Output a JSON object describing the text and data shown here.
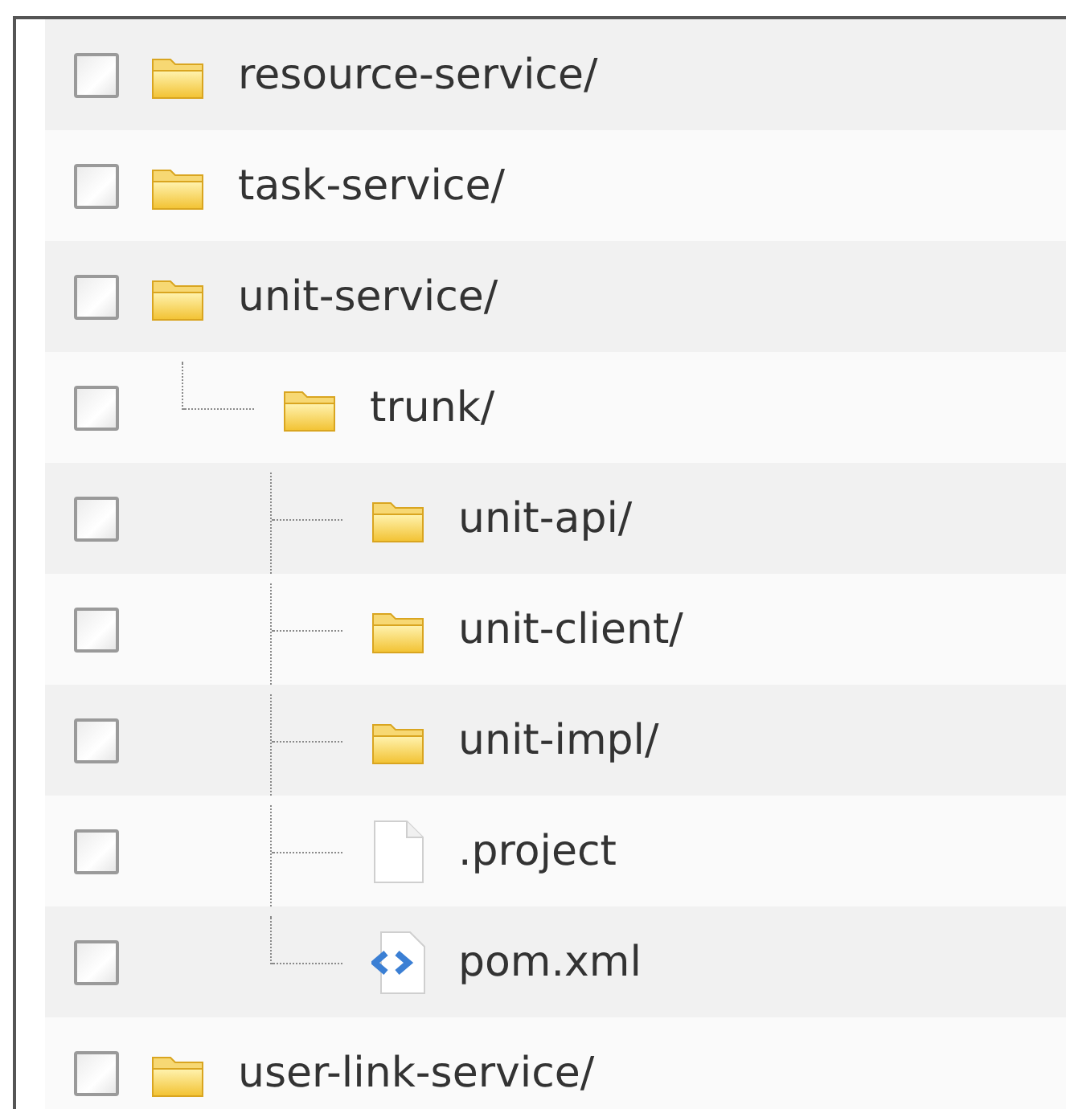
{
  "tree": [
    {
      "name": "resource-service/",
      "kind": "folder",
      "checked": false
    },
    {
      "name": "task-service/",
      "kind": "folder",
      "checked": false
    },
    {
      "name": "unit-service/",
      "kind": "folder",
      "checked": false,
      "children": [
        {
          "name": "trunk/",
          "kind": "folder",
          "checked": false,
          "children": [
            {
              "name": "unit-api/",
              "kind": "folder",
              "checked": false
            },
            {
              "name": "unit-client/",
              "kind": "folder",
              "checked": false
            },
            {
              "name": "unit-impl/",
              "kind": "folder",
              "checked": false
            },
            {
              "name": ".project",
              "kind": "file",
              "checked": false
            },
            {
              "name": "pom.xml",
              "kind": "xml-file",
              "checked": false
            }
          ]
        }
      ]
    },
    {
      "name": "user-link-service/",
      "kind": "folder",
      "checked": false
    }
  ]
}
